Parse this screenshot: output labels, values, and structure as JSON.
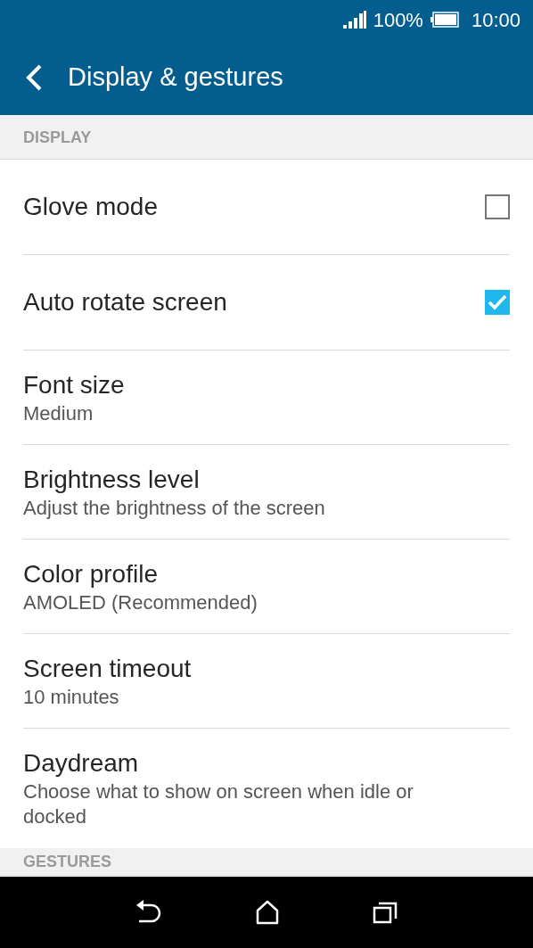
{
  "status_bar": {
    "battery": "100%",
    "time": "10:00"
  },
  "app_bar": {
    "title": "Display & gestures"
  },
  "sections": [
    {
      "header": "DISPLAY",
      "items": [
        {
          "kind": "checkbox",
          "title": "Glove mode",
          "checked": false
        },
        {
          "kind": "checkbox",
          "title": "Auto rotate screen",
          "checked": true
        },
        {
          "kind": "detail",
          "title": "Font size",
          "subtitle": "Medium"
        },
        {
          "kind": "detail",
          "title": "Brightness level",
          "subtitle": "Adjust the brightness of the screen"
        },
        {
          "kind": "detail",
          "title": "Color profile",
          "subtitle": "AMOLED (Recommended)"
        },
        {
          "kind": "detail",
          "title": "Screen timeout",
          "subtitle": "10 minutes"
        },
        {
          "kind": "detail",
          "title": "Daydream",
          "subtitle": "Choose what to show on screen when idle or docked"
        }
      ]
    },
    {
      "header": "GESTURES"
    }
  ]
}
